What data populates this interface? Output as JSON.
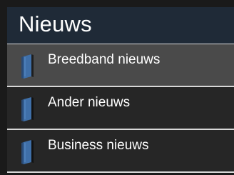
{
  "header": {
    "title": "Nieuws"
  },
  "list": {
    "items": [
      {
        "label": "Breedband nieuws",
        "icon": "book-icon",
        "selected": true
      },
      {
        "label": "Ander nieuws",
        "icon": "book-icon",
        "selected": false
      },
      {
        "label": "Business nieuws",
        "icon": "book-icon",
        "selected": false
      }
    ]
  },
  "colors": {
    "header_bg": "#1f2a37",
    "item_bg": "#262626",
    "selected_bg": "#4a4a4a",
    "divider": "#d8d8d8",
    "icon_blue": "#3f6fa8"
  }
}
